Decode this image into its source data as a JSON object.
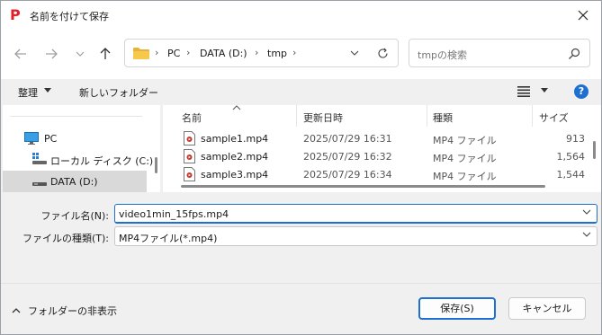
{
  "window": {
    "title": "名前を付けて保存",
    "app_icon_letter": "P",
    "accent_color": "#1e6fd0"
  },
  "address_bar": {
    "crumbs": [
      "PC",
      "DATA (D:)",
      "tmp"
    ],
    "search_placeholder": "tmpの検索"
  },
  "toolbar": {
    "organize_label": "整理",
    "new_folder_label": "新しいフォルダー",
    "help_label": "?"
  },
  "nav_pane": {
    "items": [
      {
        "label": "PC",
        "icon": "computer-icon",
        "selected": false
      },
      {
        "label": "ローカル ディスク (C:)",
        "icon": "windows-drive-icon",
        "selected": false
      },
      {
        "label": "DATA (D:)",
        "icon": "drive-icon",
        "selected": true
      }
    ]
  },
  "file_list": {
    "columns": [
      "名前",
      "更新日時",
      "種類",
      "サイズ"
    ],
    "rows": [
      {
        "name": "sample1.mp4",
        "modified": "2025/07/29 16:31",
        "type": "MP4 ファイル",
        "size": "913"
      },
      {
        "name": "sample2.mp4",
        "modified": "2025/07/29 16:32",
        "type": "MP4 ファイル",
        "size": "1,564"
      },
      {
        "name": "sample3.mp4",
        "modified": "2025/07/29 16:34",
        "type": "MP4 ファイル",
        "size": "1,544"
      }
    ]
  },
  "form": {
    "filename_label": "ファイル名(N):",
    "filename_value": "video1min_15fps.mp4",
    "filetype_label": "ファイルの種類(T):",
    "filetype_value": "MP4ファイル(*.mp4)"
  },
  "footer": {
    "hide_folders_label": "フォルダーの非表示",
    "save_label": "保存(S)",
    "cancel_label": "キャンセル"
  }
}
